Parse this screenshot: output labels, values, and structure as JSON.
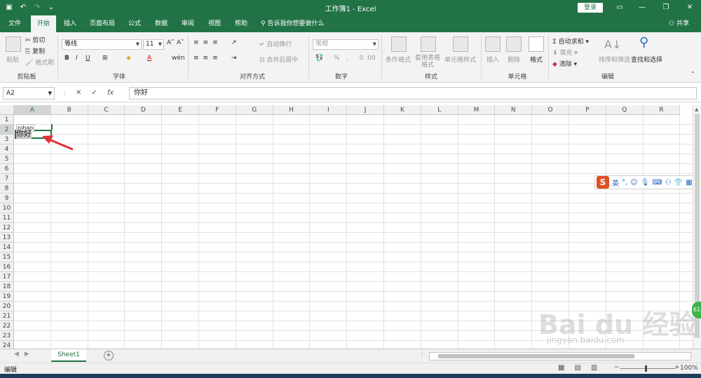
{
  "window": {
    "title": "工作簿1  -  Excel",
    "login_label": "登录",
    "share_label": "共享"
  },
  "tabs": [
    "文件",
    "开始",
    "插入",
    "页面布局",
    "公式",
    "数据",
    "审阅",
    "视图",
    "帮助"
  ],
  "active_tab": "开始",
  "tell_me": "告诉我你想要做什么",
  "ribbon": {
    "clipboard": {
      "paste": "粘贴",
      "cut": "剪切",
      "copy": "复制",
      "format_painter": "格式刷",
      "label": "剪贴板"
    },
    "font": {
      "name": "等线",
      "size": "11",
      "bold": "B",
      "italic": "I",
      "underline": "U",
      "label": "字体"
    },
    "alignment": {
      "wrap": "自动换行",
      "merge": "合并后居中",
      "label": "对齐方式"
    },
    "number": {
      "format": "常规",
      "percent": "%",
      "comma": ",",
      "label": "数字"
    },
    "styles": {
      "conditional": "条件格式",
      "table": "套用表格格式",
      "cell_styles": "单元格样式",
      "label": "样式"
    },
    "cells": {
      "insert": "插入",
      "delete": "删除",
      "format": "格式",
      "label": "单元格"
    },
    "editing": {
      "autosum": "自动求和",
      "fill": "填充",
      "clear": "清除",
      "sort": "排序和筛选",
      "find": "查找和选择",
      "label": "编辑"
    }
  },
  "formula_bar": {
    "name_box": "A2",
    "cancel": "✕",
    "enter": "✓",
    "fx": "fx",
    "content": "你好"
  },
  "columns": [
    "A",
    "B",
    "C",
    "D",
    "E",
    "F",
    "G",
    "H",
    "I",
    "J",
    "K",
    "L",
    "M",
    "N",
    "O",
    "P",
    "Q",
    "R"
  ],
  "rows": [
    "1",
    "2",
    "3",
    "4",
    "5",
    "6",
    "7",
    "8",
    "9",
    "10",
    "11",
    "12",
    "13",
    "14",
    "15",
    "16",
    "17",
    "18",
    "19",
    "20",
    "21",
    "22",
    "23",
    "24"
  ],
  "active_cell": {
    "ime_composition": "nihao",
    "value": "你好"
  },
  "ime_toolbar": {
    "logo": "S",
    "mode": "英"
  },
  "sheet_tabs": [
    "Sheet1"
  ],
  "status": {
    "mode": "编辑",
    "zoom": "100%"
  },
  "watermark": {
    "brand": "Bai du 经验",
    "url": "jingyan.baidu.com"
  },
  "colors": {
    "accent": "#217346",
    "arrow": "#e0303a"
  }
}
